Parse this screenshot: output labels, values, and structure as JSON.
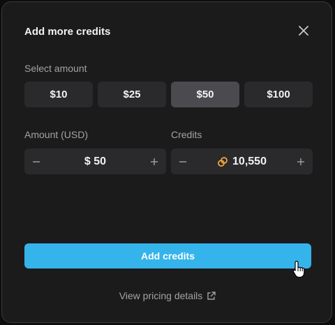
{
  "dialog": {
    "title": "Add more credits",
    "select_amount_label": "Select amount",
    "amount_options": [
      "$10",
      "$25",
      "$50",
      "$100"
    ],
    "selected_amount": "$50"
  },
  "amount_field": {
    "label": "Amount (USD)",
    "value": "$ 50"
  },
  "credits_field": {
    "label": "Credits",
    "value": "10,550",
    "icon": "credits-coin-icon"
  },
  "actions": {
    "add_label": "Add credits",
    "pricing_link": "View pricing details"
  },
  "colors": {
    "accent": "#35b4ec",
    "background": "#1b1b1b",
    "selected_option": "#4b4b4f",
    "coin_icon": "#f2a53a"
  }
}
